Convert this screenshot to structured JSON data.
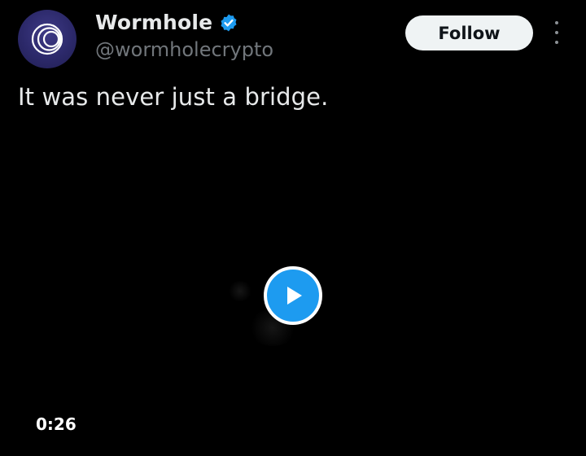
{
  "author": {
    "avatar_icon": "wormhole-logo-icon",
    "name": "Wormhole",
    "verified_icon": "verified-badge-icon",
    "handle": "@wormholecrypto"
  },
  "actions": {
    "follow_label": "Follow",
    "more_icon": "more-options-icon"
  },
  "tweet": {
    "text": "It was never just a bridge."
  },
  "video": {
    "play_icon": "play-icon",
    "duration": "0:26"
  },
  "colors": {
    "background": "#000000",
    "accent": "#1d9bf0",
    "text_primary": "#e7e9ea",
    "text_secondary": "#71767b",
    "follow_button_bg": "#eff3f4"
  }
}
